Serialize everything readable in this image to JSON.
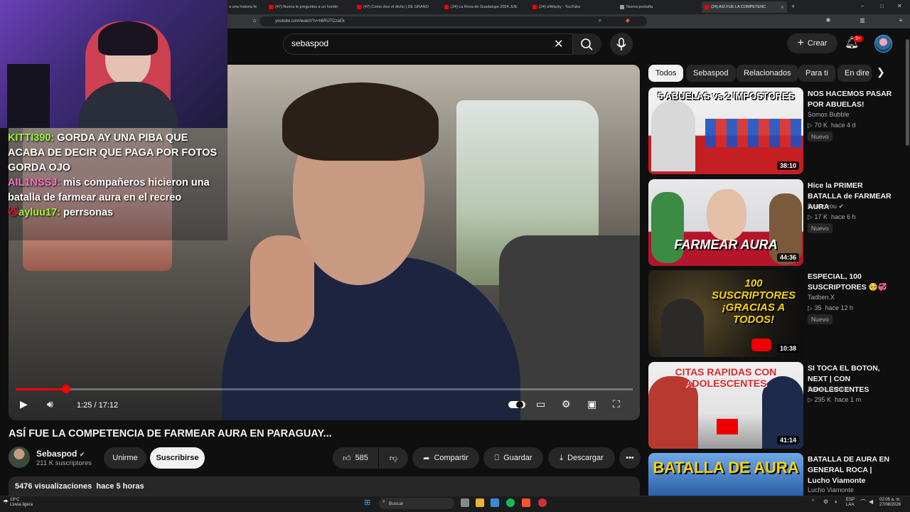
{
  "browser": {
    "tabs": [
      {
        "label": "a una historia fe"
      },
      {
        "label": "(47) Nunca le preguntes a un hombr"
      },
      {
        "label": "(47) Como dice el dicho | DE GRANO"
      },
      {
        "label": "(24) La Rosa de Guadalupe 2024 JUE"
      },
      {
        "label": "(24) elWacky - YouTube"
      },
      {
        "label": "Nueva pestaña"
      },
      {
        "label": "(24) ASÍ FUE LA COMPETENC"
      }
    ],
    "url": "youtube.com/watch?v=h6RiJ7CzaEk",
    "new_tab": "+",
    "window_controls": [
      "–",
      "□",
      "✕"
    ]
  },
  "header": {
    "search_value": "sebaspod",
    "create_label": "Crear",
    "notifications_badge": "9+"
  },
  "chat": {
    "messages": [
      {
        "user": "KITTI390:",
        "text": "GORDA AY UNA PIBA QUE ACABA DE DECIR QUE PAGA POR FOTOS GORDA OJO",
        "color": "#9cf53a"
      },
      {
        "user": "AIL1NSSJ:",
        "text": "mis compañeros hicieron una batalla de farmear aura en el recreo",
        "color": "#ff6ec7"
      },
      {
        "user": "ayluu17:",
        "text": "perrsonas",
        "color": "#9cf53a"
      }
    ]
  },
  "player": {
    "time": "1:25 / 17:12",
    "progress": 0.082
  },
  "video": {
    "title": "ASÍ FUE LA COMPETENCIA DE FARMEAR AURA EN PARAGUAY...",
    "channel": "Sebaspod",
    "subscribers": "211 K suscriptores",
    "join_label": "Unirme",
    "subscribe_label": "Suscribirse",
    "likes": "585",
    "share_label": "Compartir",
    "save_label": "Guardar",
    "download_label": "Descargar",
    "views": "5476 visualizaciones",
    "age": "hace 5 horas"
  },
  "chips": [
    "Todos",
    "Sebaspod",
    "Relacionados",
    "Para ti",
    "En dire"
  ],
  "recommendations": [
    {
      "thumb_text": "5 ABUELAS vs 2 IMPOSTORES",
      "duration": "38:10",
      "title": "NOS HACEMOS PASAR POR ABUELAS!",
      "channel": "Somos Bubble",
      "views": "70 K",
      "age": "hace 4 d",
      "badge": "Nuevo",
      "accent": "#e63b3b"
    },
    {
      "thumb_text": "FARMEAR AURA",
      "duration": "44:36",
      "title": "Hice la PRIMER BATALLA de FARMEAR AURA",
      "channel": "Bananirou",
      "views": "17 K",
      "age": "hace 6 h",
      "badge": "Nuevo",
      "accent": "#c81f2a"
    },
    {
      "thumb_text": "100 SUSCRIPTORES ¡GRACIAS A TODOS!",
      "duration": "10:38",
      "title": "ESPECIAL, 100 SUSCRIPTORES 🥺💞",
      "channel": "Tadben.X",
      "views": "35",
      "age": "hace 12 h",
      "badge": "Nuevo",
      "accent": "#f5d20a"
    },
    {
      "thumb_text": "CITAS RAPIDAS CON ADOLESCENTES",
      "duration": "41:14",
      "title": "SI TOCA EL BOTON, NEXT | CON ADOLESCENTES",
      "channel": "Somos Bubble",
      "views": "295 K",
      "age": "hace 1 m",
      "badge": "",
      "accent": "#d9262b"
    },
    {
      "thumb_text": "BATALLA DE AURA",
      "duration": "",
      "title": "BATALLA DE AURA EN GENERAL ROCA | Lucho Viamonte",
      "channel": "Lucho Viamonte",
      "views": "",
      "age": "",
      "badge": "",
      "accent": "#3a7bd5"
    }
  ],
  "taskbar": {
    "search_placeholder": "Buscar",
    "weather_temp": "19°C",
    "weather_desc": "Lluvia ligera",
    "lang_1": "ESP",
    "lang_2": "LAA",
    "time": "02:05 a. m.",
    "date": "27/08/2026"
  }
}
